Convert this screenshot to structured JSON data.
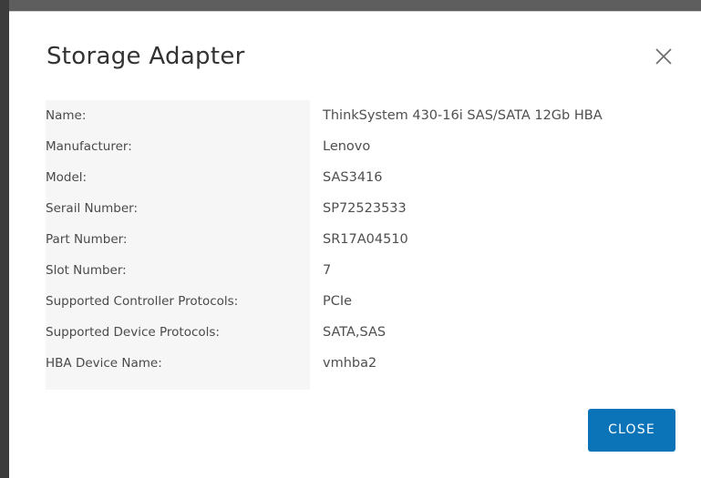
{
  "dialog": {
    "title": "Storage Adapter",
    "close_icon": "close-icon",
    "close_button_label": "CLOSE",
    "accent_color": "#0b74b8"
  },
  "properties": [
    {
      "label": "Name:",
      "value": "ThinkSystem 430-16i SAS/SATA 12Gb HBA"
    },
    {
      "label": "Manufacturer:",
      "value": "Lenovo"
    },
    {
      "label": "Model:",
      "value": "SAS3416"
    },
    {
      "label": "Serail Number:",
      "value": "SP72523533"
    },
    {
      "label": "Part Number:",
      "value": "SR17A04510"
    },
    {
      "label": "Slot Number:",
      "value": "7"
    },
    {
      "label": "Supported Controller Protocols:",
      "value": "PCIe"
    },
    {
      "label": "Supported Device Protocols:",
      "value": "SATA,SAS"
    },
    {
      "label": "HBA Device Name:",
      "value": "vmhba2"
    }
  ]
}
